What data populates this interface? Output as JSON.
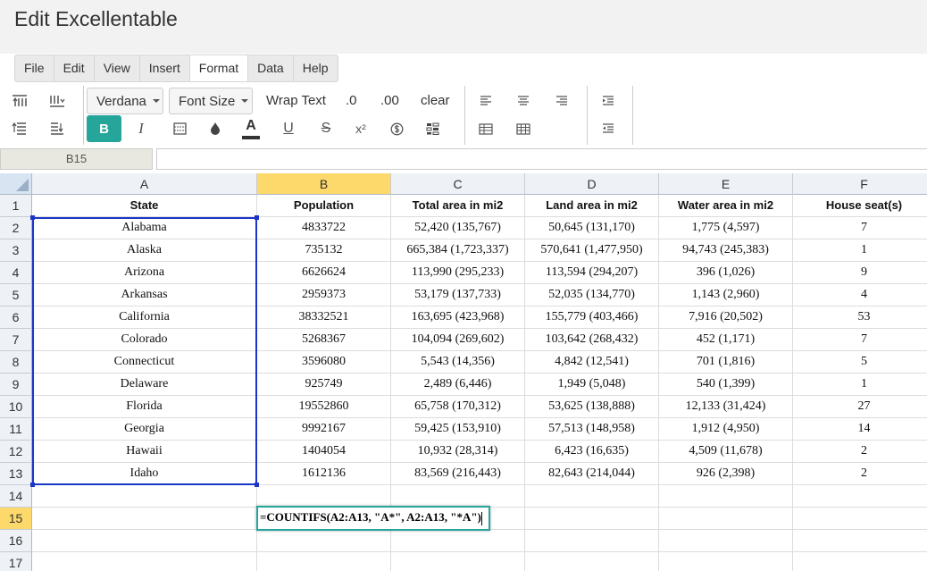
{
  "window": {
    "title": "Edit Excellentable"
  },
  "menu": [
    {
      "label": "File",
      "active": false
    },
    {
      "label": "Edit",
      "active": false
    },
    {
      "label": "View",
      "active": false
    },
    {
      "label": "Insert",
      "active": false
    },
    {
      "label": "Format",
      "active": true
    },
    {
      "label": "Data",
      "active": false
    },
    {
      "label": "Help",
      "active": false
    }
  ],
  "toolbar": {
    "font_family": "Verdana",
    "font_size": "Font Size",
    "wrap_text": "Wrap Text",
    "decimal_decrease": ".0",
    "decimal_increase": ".00",
    "clear": "clear",
    "bold": "B",
    "italic": "I",
    "font_color": "A",
    "underline": "U",
    "strikethrough": "S",
    "superscript": "x²",
    "font_color_swatch": "#333333",
    "accent_color": "#26a69a"
  },
  "formula_bar": {
    "cell_ref": "B15",
    "value": ""
  },
  "grid": {
    "columns": [
      "A",
      "B",
      "C",
      "D",
      "E",
      "F"
    ],
    "selected_column": "B",
    "selected_row": "15",
    "rows": [
      {
        "num": "1",
        "cells": [
          "State",
          "Population",
          "Total area in mi2",
          "Land area in mi2",
          "Water area in mi2",
          "House seat(s)"
        ]
      },
      {
        "num": "2",
        "cells": [
          "Alabama",
          "4833722",
          "52,420 (135,767)",
          "50,645 (131,170)",
          "1,775 (4,597)",
          "7"
        ]
      },
      {
        "num": "3",
        "cells": [
          "Alaska",
          "735132",
          "665,384 (1,723,337)",
          "570,641 (1,477,950)",
          "94,743 (245,383)",
          "1"
        ]
      },
      {
        "num": "4",
        "cells": [
          "Arizona",
          "6626624",
          "113,990 (295,233)",
          "113,594 (294,207)",
          "396 (1,026)",
          "9"
        ]
      },
      {
        "num": "5",
        "cells": [
          "Arkansas",
          "2959373",
          "53,179 (137,733)",
          "52,035 (134,770)",
          "1,143 (2,960)",
          "4"
        ]
      },
      {
        "num": "6",
        "cells": [
          "California",
          "38332521",
          "163,695 (423,968)",
          "155,779 (403,466)",
          "7,916 (20,502)",
          "53"
        ]
      },
      {
        "num": "7",
        "cells": [
          "Colorado",
          "5268367",
          "104,094 (269,602)",
          "103,642 (268,432)",
          "452 (1,171)",
          "7"
        ]
      },
      {
        "num": "8",
        "cells": [
          "Connecticut",
          "3596080",
          "5,543 (14,356)",
          "4,842 (12,541)",
          "701 (1,816)",
          "5"
        ]
      },
      {
        "num": "9",
        "cells": [
          "Delaware",
          "925749",
          "2,489 (6,446)",
          "1,949 (5,048)",
          "540 (1,399)",
          "1"
        ]
      },
      {
        "num": "10",
        "cells": [
          "Florida",
          "19552860",
          "65,758 (170,312)",
          "53,625 (138,888)",
          "12,133 (31,424)",
          "27"
        ]
      },
      {
        "num": "11",
        "cells": [
          "Georgia",
          "9992167",
          "59,425 (153,910)",
          "57,513 (148,958)",
          "1,912 (4,950)",
          "14"
        ]
      },
      {
        "num": "12",
        "cells": [
          "Hawaii",
          "1404054",
          "10,932 (28,314)",
          "6,423 (16,635)",
          "4,509 (11,678)",
          "2"
        ]
      },
      {
        "num": "13",
        "cells": [
          "Idaho",
          "1612136",
          "83,569 (216,443)",
          "82,643 (214,044)",
          "926 (2,398)",
          "2"
        ]
      },
      {
        "num": "14",
        "cells": [
          "",
          "",
          "",
          "",
          "",
          ""
        ]
      },
      {
        "num": "15",
        "cells": [
          "",
          "",
          "",
          "",
          "",
          ""
        ]
      },
      {
        "num": "16",
        "cells": [
          "",
          "",
          "",
          "",
          "",
          ""
        ]
      },
      {
        "num": "17",
        "cells": [
          "",
          "",
          "",
          "",
          "",
          ""
        ]
      }
    ]
  },
  "editor": {
    "value": "=COUNTIFS(A2:A13, \"A*\", A2:A13, \"*A\")"
  }
}
